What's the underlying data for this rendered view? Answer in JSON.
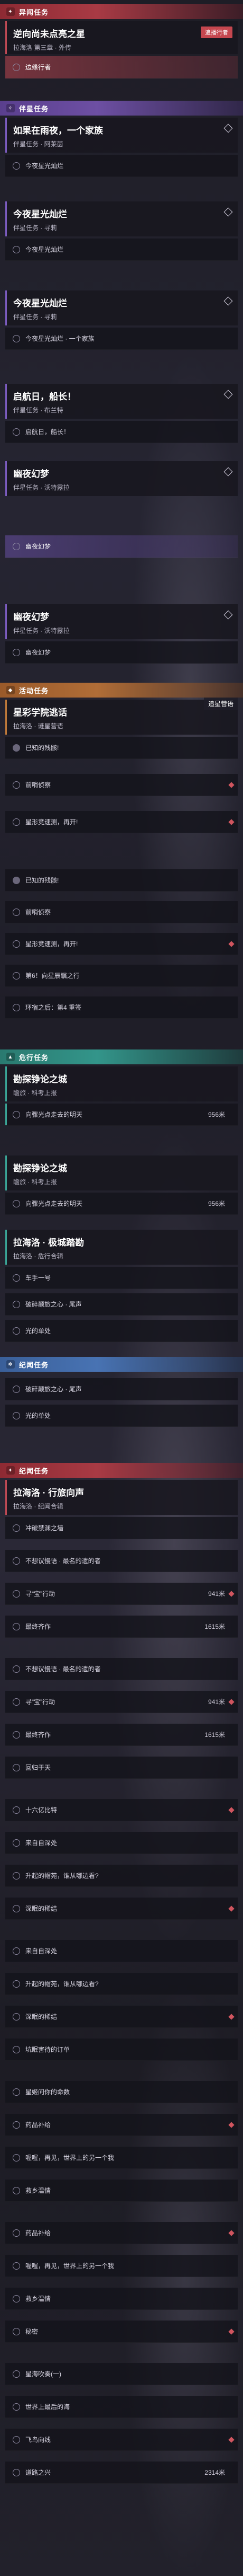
{
  "sections": {
    "s1": "异闻任务",
    "s2": "伴星任务",
    "s3": "活动任务",
    "s4": "危行任务",
    "s5": "纪闻任务",
    "s6": "纪闻任务"
  },
  "quest1": {
    "title": "逆向尚未点亮之星",
    "sub": "拉海洛 第三章 · 外传",
    "tag": "追播行者",
    "obj1": "边缘行者"
  },
  "quest2": {
    "title": "如果在雨夜，一个家族",
    "sub": "伴星任务 · 阿莱茵",
    "obj1": "今夜星光灿烂"
  },
  "quest3": {
    "title": "今夜星光灿烂",
    "sub": "伴星任务 · 寻莉",
    "obj1": "今夜星光灿烂"
  },
  "quest4": {
    "title": "今夜星光灿烂",
    "sub": "伴星任务 · 寻莉",
    "obj1": "今夜星光灿烂 · 一个家族"
  },
  "quest5": {
    "title": "启航日，船长！",
    "sub": "伴星任务 · 布兰特",
    "obj1": "启航日，船长！"
  },
  "quest6": {
    "title": "幽夜幻梦",
    "sub": "伴星任务 · 沃特露拉",
    "obj1": "幽夜幻梦"
  },
  "quest7": {
    "title": "幽夜幻梦",
    "sub": "伴星任务 · 沃特露拉",
    "obj1": "幽夜幻梦"
  },
  "quest8": {
    "title": "星彩学院逃话",
    "sub": "拉海洛 · 谜星营语",
    "tracker": "追星营语",
    "objs": [
      "已知的残骸!",
      "前哨侦察",
      "星形竞速测，再开!",
      "已知的残骸!",
      "前哨侦察",
      "星形竞速测，再开!",
      "第6！向星辰瞩之行",
      "环宿之后：第4 重签"
    ]
  },
  "quest9": {
    "title": "勘探铮论之城",
    "sub": "瞻旅 · 科考上报",
    "obj1": "向骤光点走去的明天",
    "cnt1": "956米"
  },
  "quest10": {
    "title": "勘探铮论之城",
    "sub": "瞻旅 · 科考上报",
    "obj1": "向骤光点走去的明天",
    "cnt1": "956米"
  },
  "quest11": {
    "title": "拉海洛 · 极城踏勘",
    "sub": "拉海洛 · 危行合辑",
    "objs": [
      "车手一号",
      "破碎颠旅之心 · 尾声",
      "光的单处"
    ]
  },
  "quest12": {
    "objs": [
      "破碎颠旅之心 · 尾声",
      "光的单处"
    ]
  },
  "quest13": {
    "title": "拉海洛 · 行旅向声",
    "sub": "拉海洛 · 纪闻合辑",
    "objs": [
      {
        "t": "冲破禁渊之墙",
        "c": ""
      },
      {
        "t": "不想议慢语 · 最名的遗的者",
        "c": ""
      },
      {
        "t": "寻“宝”行动",
        "c": "941米"
      },
      {
        "t": "最终齐作",
        "c": "1615米"
      },
      {
        "t": "不想议慢语 · 最名的遗的者",
        "c": ""
      },
      {
        "t": "寻“宝”行动",
        "c": "941米"
      },
      {
        "t": "最终齐作",
        "c": "1615米"
      },
      {
        "t": "回归于天",
        "c": ""
      },
      {
        "t": "十六亿比特",
        "c": ""
      },
      {
        "t": "来自自深处",
        "c": ""
      },
      {
        "t": "升起的帽苑，谁从哪边看?",
        "c": ""
      },
      {
        "t": "深眠的稀结",
        "c": ""
      },
      {
        "t": "来自自深处",
        "c": ""
      },
      {
        "t": "升起的帽苑，谁从哪边看?",
        "c": ""
      },
      {
        "t": "深眠的稀结",
        "c": ""
      },
      {
        "t": "坑眠害待的订单",
        "c": ""
      },
      {
        "t": "星姬问你的命数",
        "c": ""
      },
      {
        "t": "药品补给",
        "c": ""
      },
      {
        "t": "喔喔，再见，世界上的另一个我",
        "c": ""
      },
      {
        "t": "救乡温情",
        "c": ""
      },
      {
        "t": "药品补给",
        "c": ""
      },
      {
        "t": "喔喔，再见，世界上的另一个我",
        "c": ""
      },
      {
        "t": "救乡温情",
        "c": ""
      },
      {
        "t": "秘密",
        "c": ""
      },
      {
        "t": "星海吹奏(一)",
        "c": ""
      },
      {
        "t": "世界上最后的海",
        "c": ""
      },
      {
        "t": "飞鸟向线",
        "c": ""
      },
      {
        "t": "道路之兴",
        "c": "2314米"
      }
    ]
  },
  "colors": {
    "red": "#c04a55",
    "purple": "#7c5cc0",
    "orange": "#c07a3a",
    "teal": "#3aa597",
    "blue": "#5a85c9"
  }
}
